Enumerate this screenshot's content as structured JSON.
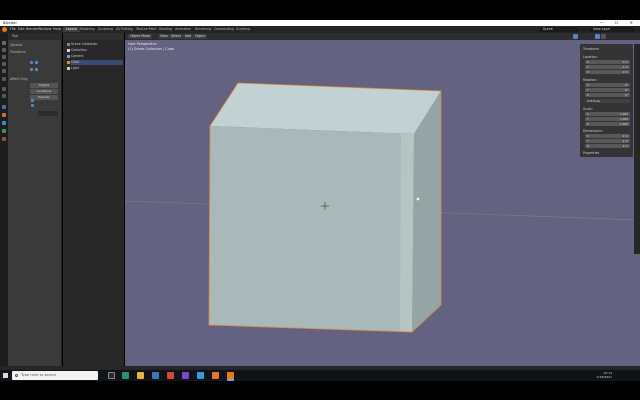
{
  "window": {
    "title": "Blender",
    "controls": "— ☐ ✕"
  },
  "menu": [
    "File",
    "Edit",
    "Render",
    "Window",
    "Help"
  ],
  "workspace_tabs": [
    "Layout",
    "Modeling",
    "Sculpting",
    "UV Editing",
    "Texture Paint",
    "Shading",
    "Animation",
    "Rendering",
    "Compositing",
    "Scripting"
  ],
  "active_workspace": "Layout",
  "scene": "Scene",
  "view_layer": "View Layer",
  "properties_panel": {
    "header": "Tool",
    "rows": [
      "Options",
      "Transform",
      "Affect Only"
    ],
    "label_origins": "Origins",
    "label_locations": "Locations",
    "label_parents": "Parents"
  },
  "outliner": {
    "items": [
      "Scene Collection",
      "Collection",
      "Camera",
      "Cube",
      "Light"
    ],
    "selected": "Cube"
  },
  "viewport": {
    "header_buttons": [
      "Object Mode",
      "View",
      "Select",
      "Add",
      "Object"
    ],
    "overlay_line1": "User Perspective",
    "overlay_line2": "(1) Scene Collection | Cube"
  },
  "transform_panel": {
    "title": "Transform",
    "location_label": "Location:",
    "rotation_label": "Rotation:",
    "rotation_mode": "XYZ Euler",
    "scale_label": "Scale:",
    "dimensions_label": "Dimensions:",
    "properties_label": "Properties",
    "location": [
      {
        "axis": "X",
        "value": "0 m"
      },
      {
        "axis": "Y",
        "value": "0 m"
      },
      {
        "axis": "Z",
        "value": "0 m"
      }
    ],
    "rotation": [
      {
        "axis": "X",
        "value": "0°"
      },
      {
        "axis": "Y",
        "value": "0°"
      },
      {
        "axis": "Z",
        "value": "0°"
      }
    ],
    "scale": [
      {
        "axis": "X",
        "value": "1.000"
      },
      {
        "axis": "Y",
        "value": "1.000"
      },
      {
        "axis": "Z",
        "value": "1.000"
      }
    ],
    "dimensions": [
      {
        "axis": "X",
        "value": "2 m"
      },
      {
        "axis": "Y",
        "value": "2 m"
      },
      {
        "axis": "Z",
        "value": "2 m"
      }
    ]
  },
  "taskbar": {
    "search_placeholder": "Type here to search",
    "time": "10:14",
    "date": "2/16/2021"
  },
  "colors": {
    "viewport_bg": "#636381",
    "cube_top": "#c2d2d2",
    "cube_front": "#a9b8b8",
    "cube_side": "#95a4a4",
    "selection_outline": "#e08a3c",
    "accent": "#5b83c4"
  }
}
